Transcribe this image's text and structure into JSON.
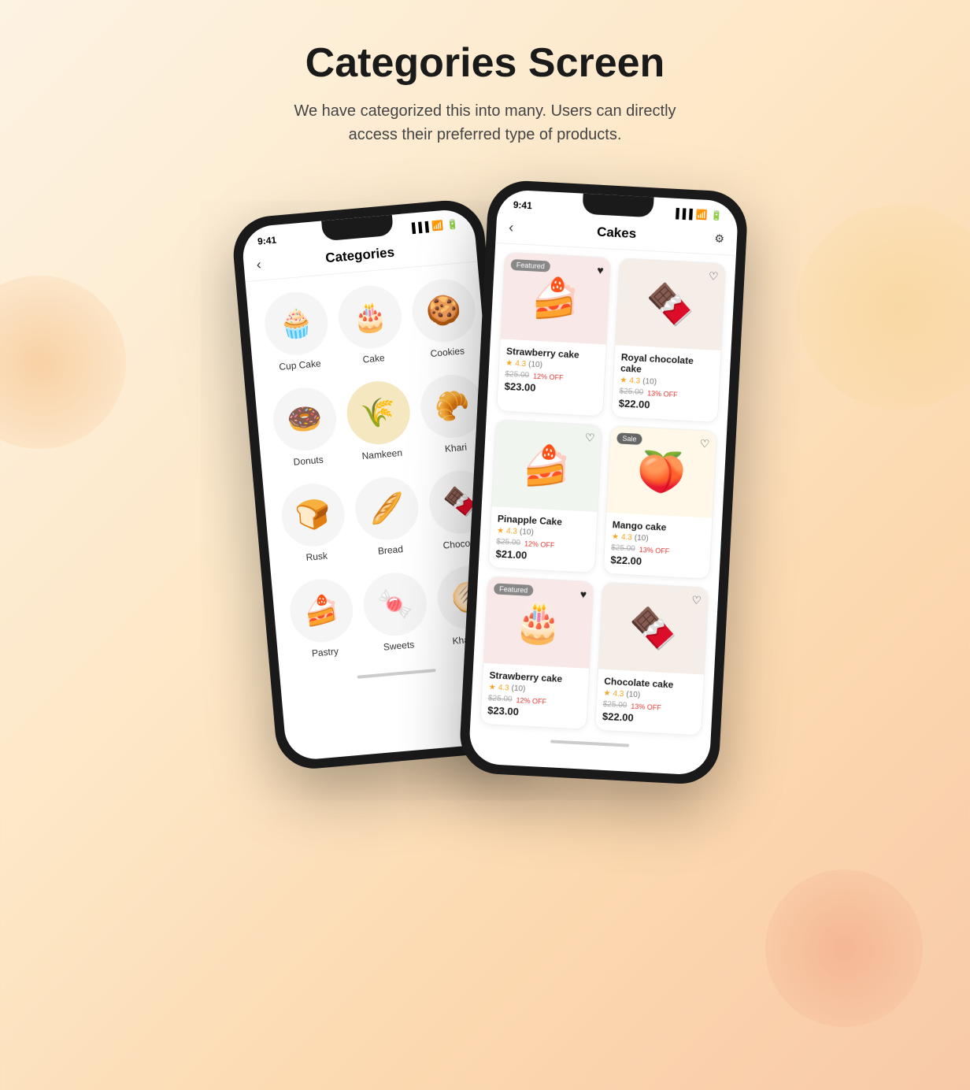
{
  "page": {
    "title": "Categories Screen",
    "subtitle": "We have categorized this into many. Users can directly access their preferred type of products."
  },
  "phone_left": {
    "time": "9:41",
    "screen_title": "Categories",
    "categories": [
      {
        "label": "Cup Cake",
        "icon": "🧁"
      },
      {
        "label": "Cake",
        "icon": "🎂"
      },
      {
        "label": "Cookies",
        "icon": "🍪"
      },
      {
        "label": "Donuts",
        "icon": "🍩"
      },
      {
        "label": "Namkeen",
        "icon": "🌾"
      },
      {
        "label": "Khari",
        "icon": "🥐"
      },
      {
        "label": "Rusk",
        "icon": "🍞"
      },
      {
        "label": "Bread",
        "icon": "🥖"
      },
      {
        "label": "Chocolate",
        "icon": "🍫"
      },
      {
        "label": "Pastry",
        "icon": "🍰"
      },
      {
        "label": "Sweets",
        "icon": "🍬"
      },
      {
        "label": "Khakhara",
        "icon": "🫓"
      }
    ]
  },
  "phone_right": {
    "time": "9:41",
    "screen_title": "Cakes",
    "products": [
      {
        "name": "Strawberry cake",
        "rating": "4.3",
        "rating_count": "(10)",
        "original_price": "$25.00",
        "discount": "12% OFF",
        "final_price": "$23.00",
        "badge": "Featured",
        "badge_type": "featured",
        "heart": "filled",
        "icon": "🎂",
        "bg": "#f9e8e8"
      },
      {
        "name": "Royal chocolate cake",
        "rating": "4.3",
        "rating_count": "(10)",
        "original_price": "$25.00",
        "discount": "13% OFF",
        "final_price": "$22.00",
        "badge": "",
        "badge_type": "",
        "heart": "outline",
        "icon": "🍫",
        "bg": "#f5ede8"
      },
      {
        "name": "Pinapple Cake",
        "rating": "4.3",
        "rating_count": "(10)",
        "original_price": "$25.00",
        "discount": "12% OFF",
        "final_price": "$21.00",
        "badge": "",
        "badge_type": "",
        "heart": "outline",
        "icon": "🍰",
        "bg": "#f0f5f0"
      },
      {
        "name": "Mango cake",
        "rating": "4.3",
        "rating_count": "(10)",
        "original_price": "$25.00",
        "discount": "13% OFF",
        "final_price": "$22.00",
        "badge": "Sale",
        "badge_type": "sale",
        "heart": "outline",
        "icon": "🍑",
        "bg": "#fff8e8"
      },
      {
        "name": "Strawberry cake",
        "rating": "4.3",
        "rating_count": "(10)",
        "original_price": "$25.00",
        "discount": "12% OFF",
        "final_price": "$23.00",
        "badge": "Featured",
        "badge_type": "featured",
        "heart": "filled",
        "icon": "🎂",
        "bg": "#f9e8e8"
      },
      {
        "name": "Chocolate cake",
        "rating": "4.3",
        "rating_count": "(10)",
        "original_price": "$25.00",
        "discount": "13% OFF",
        "final_price": "$22.00",
        "badge": "",
        "badge_type": "",
        "heart": "outline",
        "icon": "🍫",
        "bg": "#f5ede8"
      }
    ]
  }
}
